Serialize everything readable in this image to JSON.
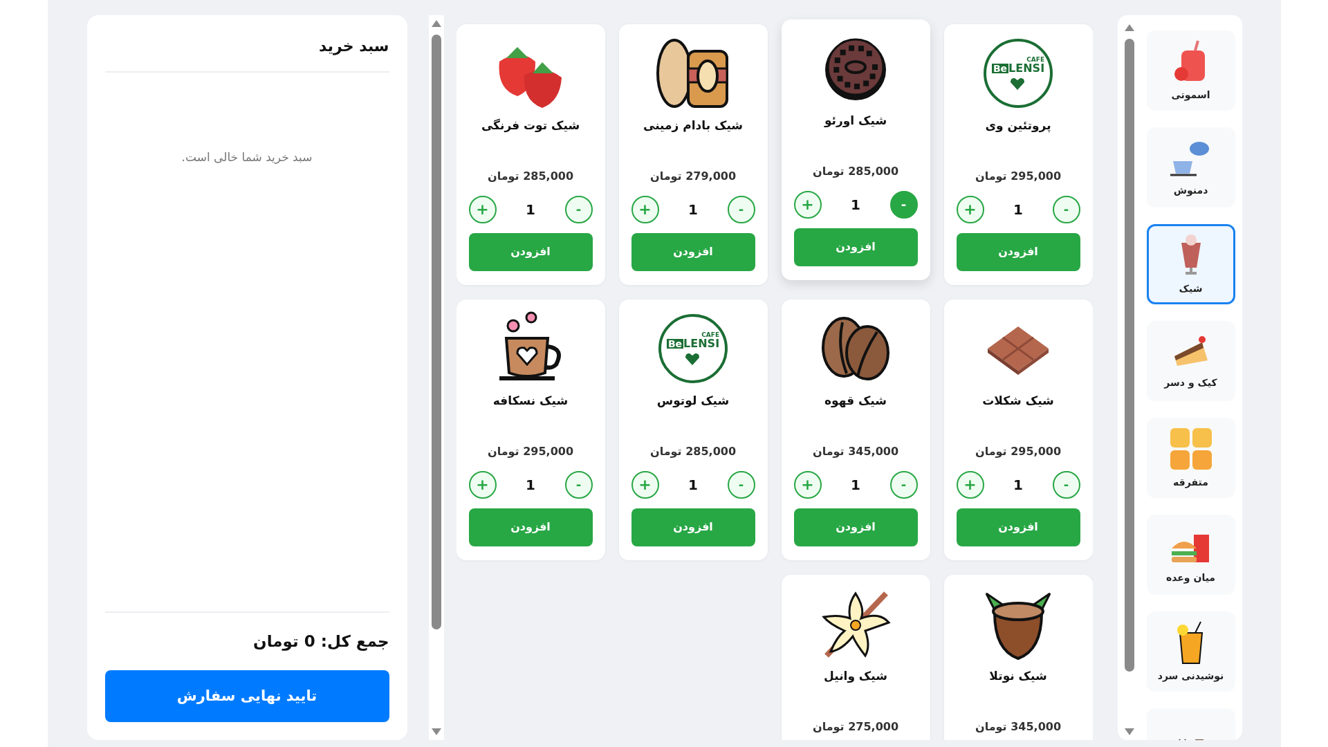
{
  "cart": {
    "title": "سبد خرید",
    "empty_message": "سبد خرید شما خالی است.",
    "total": "جمع کل: 0 تومان",
    "confirm_button": "تایید نهایی سفارش"
  },
  "products": [
    {
      "name": "پروتئین وی",
      "price": "295,000 تومان",
      "decrement": "-",
      "quantity": "1",
      "increment": "+",
      "button": "افزودن",
      "hovered": false,
      "logo_text": [
        "CAFE",
        "Be",
        "LENSI"
      ]
    },
    {
      "name": "شیک اورئو",
      "price": "285,000 تومان",
      "decrement": "-",
      "quantity": "1",
      "increment": "+",
      "button": "افزودن",
      "hovered": true
    },
    {
      "name": "شیک بادام زمینی",
      "price": "279,000 تومان",
      "decrement": "-",
      "quantity": "1",
      "increment": "+",
      "button": "افزودن",
      "hovered": false
    },
    {
      "name": "شیک توت فرنگی",
      "price": "285,000 تومان",
      "decrement": "-",
      "quantity": "1",
      "increment": "+",
      "button": "افزودن",
      "hovered": false
    },
    {
      "name": "شیک شکلات",
      "price": "295,000 تومان",
      "decrement": "-",
      "quantity": "1",
      "increment": "+",
      "button": "افزودن",
      "hovered": false
    },
    {
      "name": "شیک قهوه",
      "price": "345,000 تومان",
      "decrement": "-",
      "quantity": "1",
      "increment": "+",
      "button": "افزودن",
      "hovered": false
    },
    {
      "name": "شیک لوتوس",
      "price": "285,000 تومان",
      "decrement": "-",
      "quantity": "1",
      "increment": "+",
      "button": "افزودن",
      "hovered": false,
      "logo_text": [
        "CAFE",
        "Be",
        "LENSI"
      ]
    },
    {
      "name": "شیک نسکافه",
      "price": "295,000 تومان",
      "decrement": "-",
      "quantity": "1",
      "increment": "+",
      "button": "افزودن",
      "hovered": false
    },
    {
      "name": "شیک نوتلا",
      "price": "345,000 تومان",
      "hovered": false
    },
    {
      "name": "شیک وانیل",
      "price": "275,000 تومان",
      "hovered": false
    }
  ],
  "categories": [
    {
      "label": "اسموتی",
      "selected": false
    },
    {
      "label": "دمنوش",
      "selected": false
    },
    {
      "label": "شیک",
      "selected": true
    },
    {
      "label": "کیک و دسر",
      "selected": false
    },
    {
      "label": "متفرقه",
      "selected": false
    },
    {
      "label": "میان وعده",
      "selected": false
    },
    {
      "label": "نوشیدنی سرد",
      "selected": false
    },
    {
      "selected": false
    }
  ]
}
